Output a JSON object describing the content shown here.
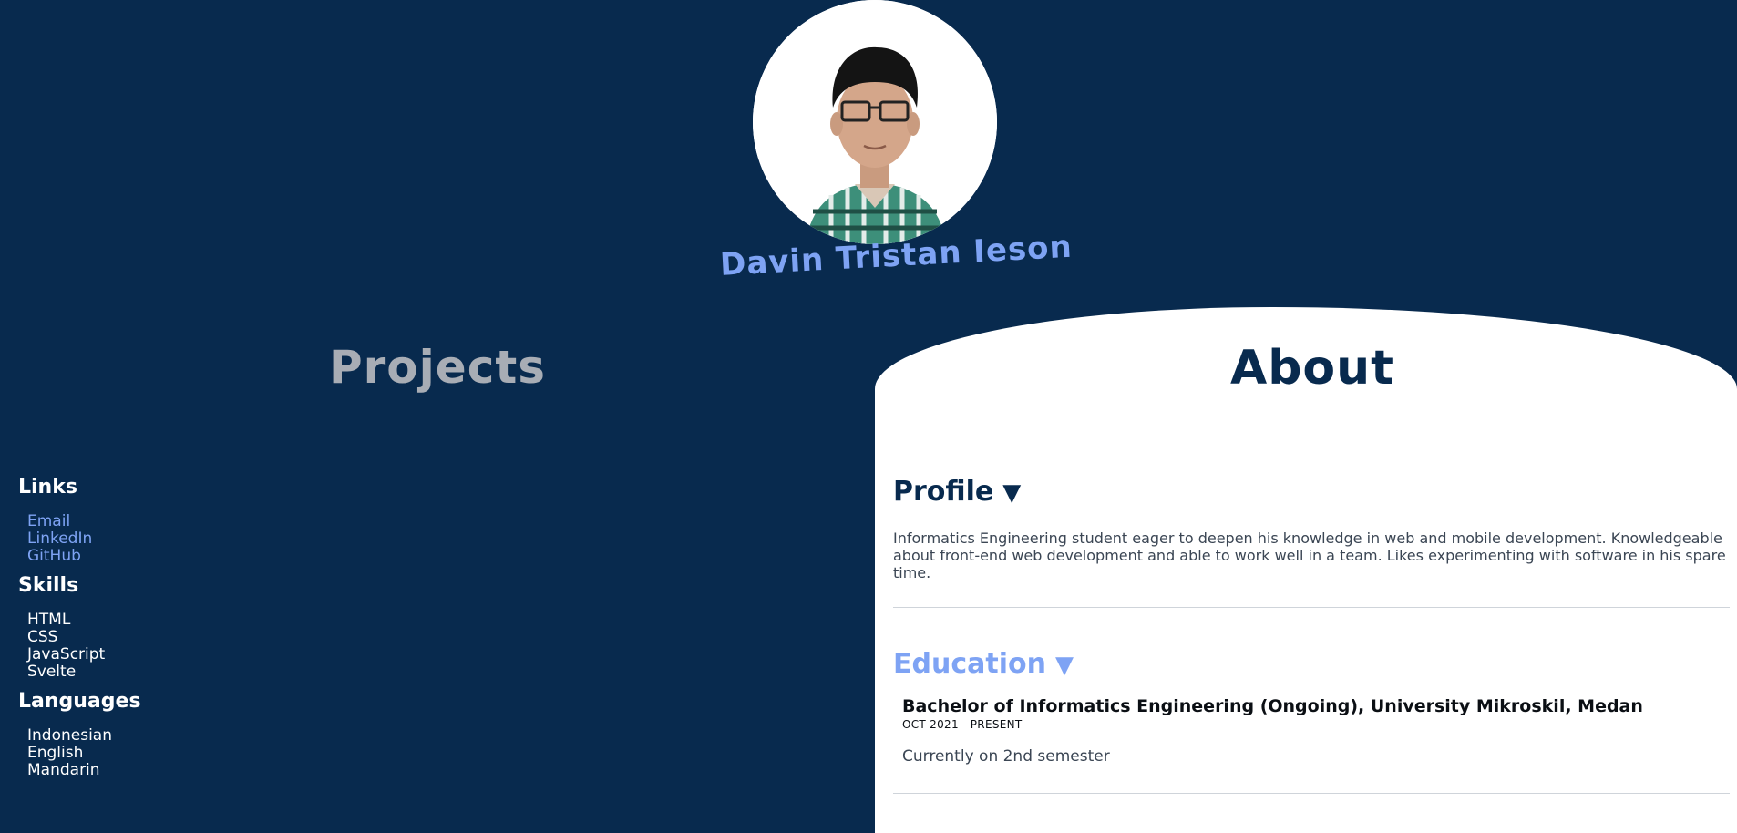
{
  "profile": {
    "name": "Davin Tristan Ieson"
  },
  "sections": {
    "projects_title": "Projects",
    "about_title": "About"
  },
  "sidebar": {
    "links_heading": "Links",
    "links": [
      "Email",
      "LinkedIn",
      "GitHub"
    ],
    "skills_heading": "Skills",
    "skills": [
      "HTML",
      "CSS",
      "JavaScript",
      "Svelte"
    ],
    "languages_heading": "Languages",
    "languages": [
      "Indonesian",
      "English",
      "Mandarin"
    ]
  },
  "about": {
    "profile_heading": "Profile",
    "profile_arrow": "▼",
    "profile_text": "Informatics Engineering student eager to deepen his knowledge in web and mobile development. Knowledgeable about front-end web development and able to work well in a team. Likes experimenting with software in his spare time.",
    "education_heading": "Education",
    "education_arrow": "▼",
    "education": {
      "title": "Bachelor of Informatics Engineering (Ongoing), University Mikroskil, Medan",
      "date": "OCT 2021 - PRESENT",
      "note": "Currently on 2nd semester"
    }
  },
  "colors": {
    "background": "#082a4e",
    "accent": "#7ea3f4",
    "panel": "#ffffff",
    "muted_heading": "#a8adb5"
  }
}
